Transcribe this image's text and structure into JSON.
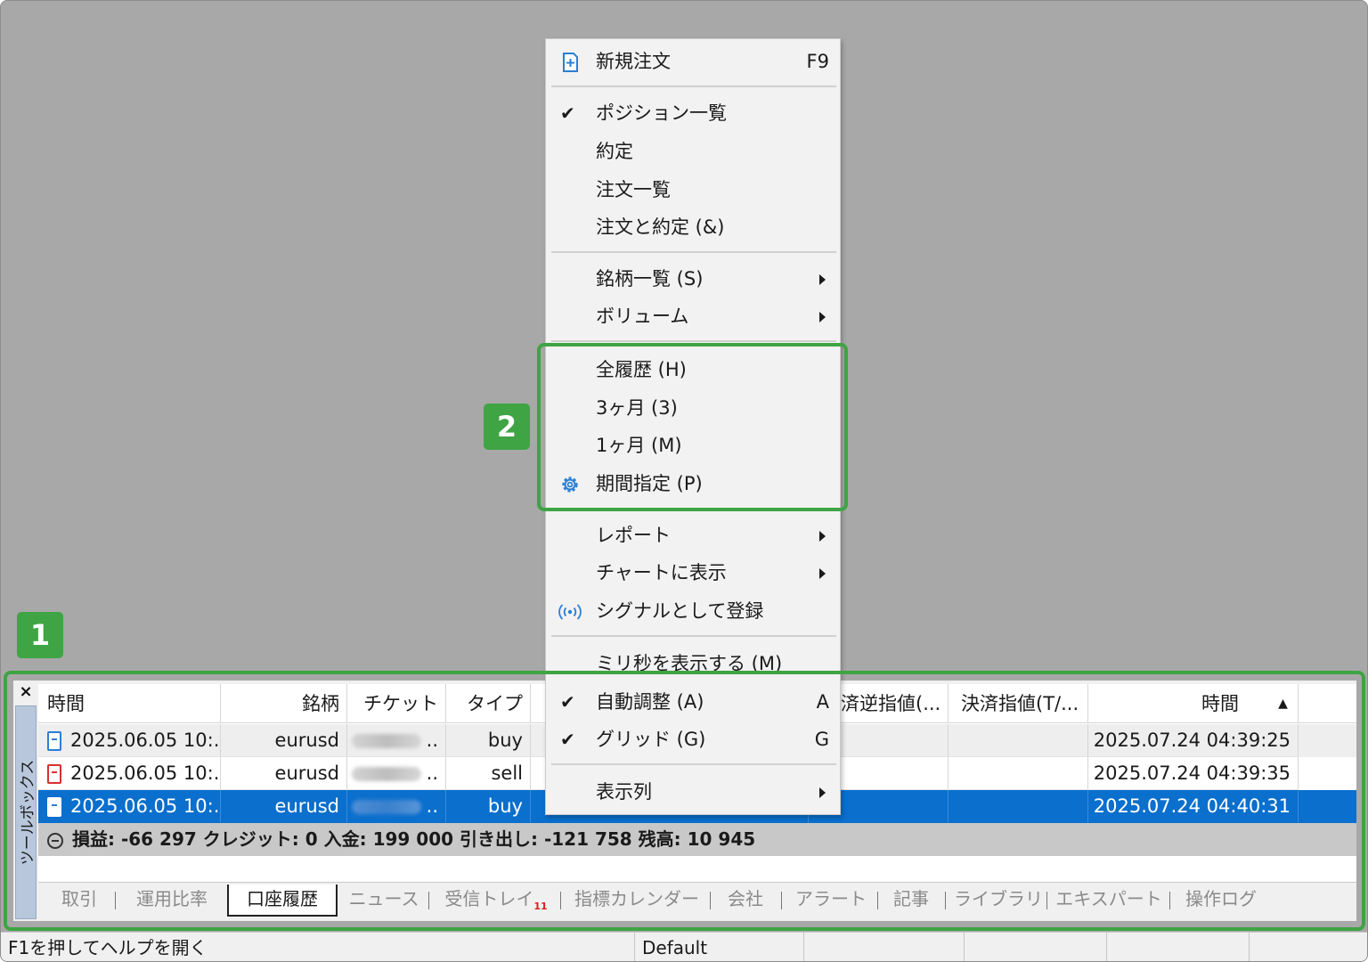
{
  "toolbox": {
    "close_glyph": "×",
    "vertical_tab": "ツールボックス",
    "columns": [
      "時間",
      "銘柄",
      "チケット",
      "タイプ",
      "済逆指値(...",
      "決済指値(T/...",
      "時間"
    ],
    "sort_indicator": "▲",
    "rows": [
      {
        "time": "2025.06.05 10:...",
        "symbol": "eurusd",
        "ticket_suffix": "..",
        "type": "buy",
        "close_time": "2025.07.24 04:39:25",
        "icon": "document-icon-blue"
      },
      {
        "time": "2025.06.05 10:...",
        "symbol": "eurusd",
        "ticket_suffix": "..",
        "type": "sell",
        "close_time": "2025.07.24 04:39:35",
        "icon": "document-icon-red"
      },
      {
        "time": "2025.06.05 10:...",
        "symbol": "eurusd",
        "ticket_suffix": "..",
        "type": "buy",
        "close_time": "2025.07.24 04:40:31",
        "icon": "document-icon-blue"
      }
    ],
    "summary": "損益: -66 297  クレジット: 0  入金: 199 000  引き出し: -121 758  残高: 10 945",
    "tabs": [
      "取引",
      "運用比率",
      "口座履歴",
      "ニュース",
      "受信トレイ",
      "指標カレンダー",
      "会社",
      "アラート",
      "記事",
      "ライブラリ",
      "エキスパート",
      "操作ログ"
    ],
    "inbox_count": "11",
    "active_tab": "口座履歴"
  },
  "statusbar": {
    "help": "F1を押してヘルプを開く",
    "profile": "Default"
  },
  "context_menu": {
    "new_order": {
      "label": "新規注文",
      "shortcut": "F9",
      "icon": "new-order-icon"
    },
    "positions": {
      "label": "ポジション一覧",
      "checked": true
    },
    "deals": {
      "label": "約定"
    },
    "orders": {
      "label": "注文一覧"
    },
    "orders_deals": {
      "label": "注文と約定 (&)"
    },
    "symbols": {
      "label": "銘柄一覧 (S)",
      "submenu": true
    },
    "volume": {
      "label": "ボリューム",
      "submenu": true
    },
    "all_history": {
      "label": "全履歴 (H)"
    },
    "three_months": {
      "label": "3ヶ月 (3)"
    },
    "one_month": {
      "label": "1ヶ月 (M)"
    },
    "custom_period": {
      "label": "期間指定 (P)",
      "icon": "gear-icon"
    },
    "report": {
      "label": "レポート",
      "submenu": true
    },
    "show_on_chart": {
      "label": "チャートに表示",
      "submenu": true
    },
    "register_signal": {
      "label": "シグナルとして登録",
      "icon": "signal-icon"
    },
    "show_ms": {
      "label": "ミリ秒を表示する (M)"
    },
    "auto_arrange": {
      "label": "自動調整 (A)",
      "shortcut": "A",
      "checked": true
    },
    "grid": {
      "label": "グリッド (G)",
      "shortcut": "G",
      "checked": true
    },
    "columns": {
      "label": "表示列",
      "submenu": true
    },
    "check_glyph": "✔"
  },
  "annotations": {
    "badge1": "1",
    "badge2": "2",
    "color": "#3fa444"
  }
}
